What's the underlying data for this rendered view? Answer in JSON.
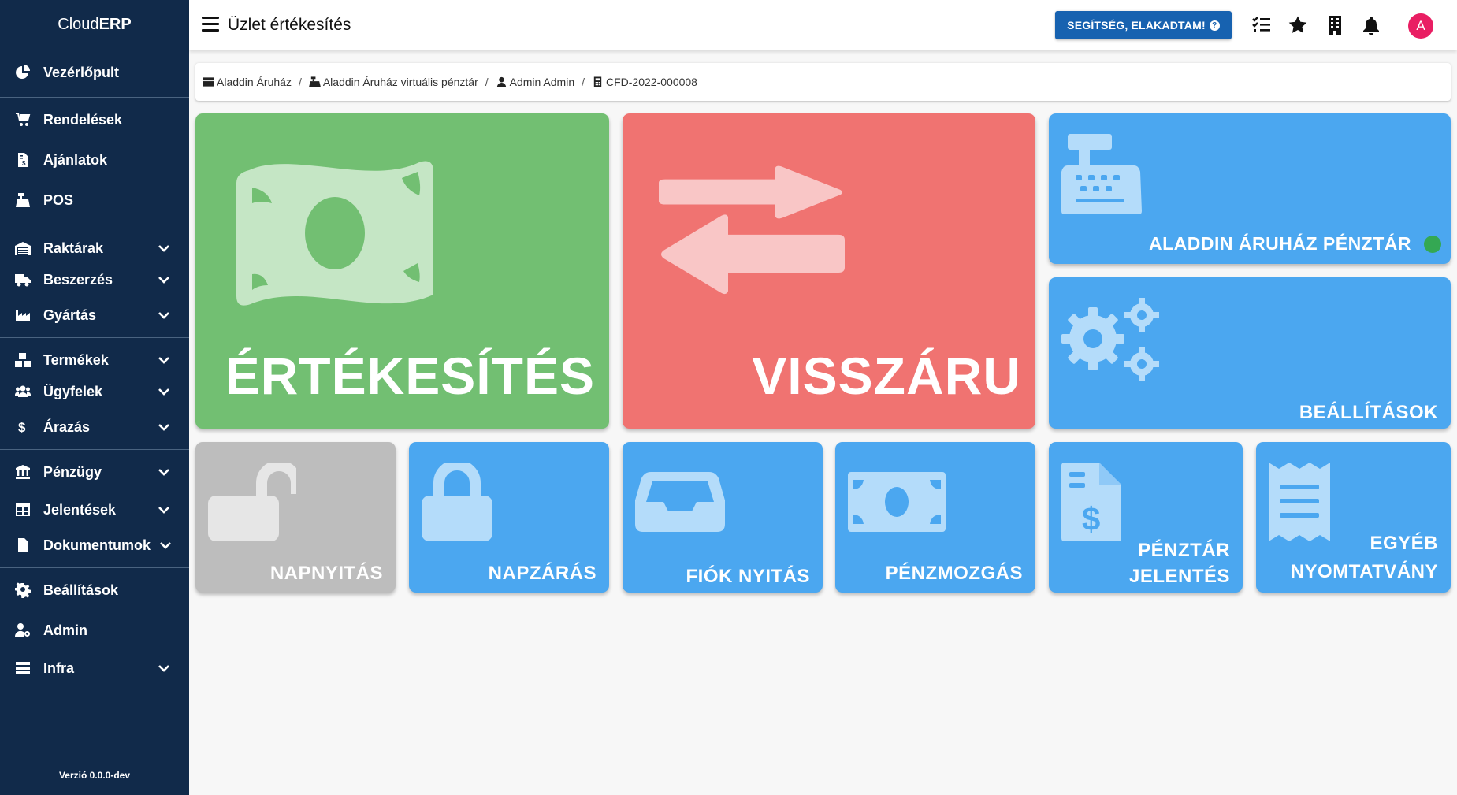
{
  "sidebar": {
    "brand_regular": "Cloud",
    "brand_bold": "ERP",
    "items": [
      {
        "label": "Vezérlőpult",
        "icon": "chart-pie-icon"
      },
      {
        "label": "Rendelések",
        "icon": "shopping-cart-icon"
      },
      {
        "label": "Ajánlatok",
        "icon": "invoice-icon"
      },
      {
        "label": "POS",
        "icon": "cash-register-icon"
      },
      {
        "label": "Raktárak",
        "icon": "warehouse-icon"
      },
      {
        "label": "Beszerzés",
        "icon": "truck-icon"
      },
      {
        "label": "Gyártás",
        "icon": "industry-icon"
      },
      {
        "label": "Termékek",
        "icon": "boxes-icon"
      },
      {
        "label": "Ügyfelek",
        "icon": "users-icon"
      },
      {
        "label": "Árazás",
        "icon": "dollar-icon"
      },
      {
        "label": "Pénzügy",
        "icon": "bank-icon"
      },
      {
        "label": "Jelentések",
        "icon": "table-icon"
      },
      {
        "label": "Dokumentumok",
        "icon": "file-icon"
      },
      {
        "label": "Beállítások",
        "icon": "gear-icon"
      },
      {
        "label": "Admin",
        "icon": "user-cog-icon"
      },
      {
        "label": "Infra",
        "icon": "server-icon"
      }
    ],
    "version": "Verzió 0.0.0-dev"
  },
  "topbar": {
    "title": "Üzlet értékesítés",
    "help_label": "SEGÍTSÉG, ELAKADTAM!",
    "avatar_letter": "A",
    "icons": [
      "tasks-icon",
      "star-icon",
      "building-icon",
      "bell-icon"
    ]
  },
  "breadcrumb": [
    {
      "label": "Aladdin Áruház",
      "icon": "store-icon"
    },
    {
      "label": "Aladdin Áruház virtuális pénztár",
      "icon": "cash-register-icon"
    },
    {
      "label": "Admin Admin",
      "icon": "user-icon"
    },
    {
      "label": "CFD-2022-000008",
      "icon": "calculator-icon"
    }
  ],
  "tiles": {
    "sale": "ÉRTÉKESÍTÉS",
    "refund": "VISSZÁRU",
    "register": "ALADDIN ÁRUHÁZ PÉNZTÁR",
    "settings": "BEÁLLÍTÁSOK",
    "day_open": "NAPNYITÁS",
    "day_close": "NAPZÁRÁS",
    "drawer_open": "FIÓK NYITÁS",
    "cash_move": "PÉNZMOZGÁS",
    "register_report_1": "PÉNZTÁR",
    "register_report_2": "JELENTÉS",
    "other_print_1": "EGYÉB",
    "other_print_2": "NYOMTATVÁNY"
  },
  "colors": {
    "sidebar": "#112a4a",
    "green": "#72bf72",
    "red": "#f07371",
    "blue": "#4ba7f0",
    "gray": "#bdbdbd",
    "status_online": "#34a853",
    "help_button": "#1762b0",
    "avatar": "#e91e63"
  }
}
